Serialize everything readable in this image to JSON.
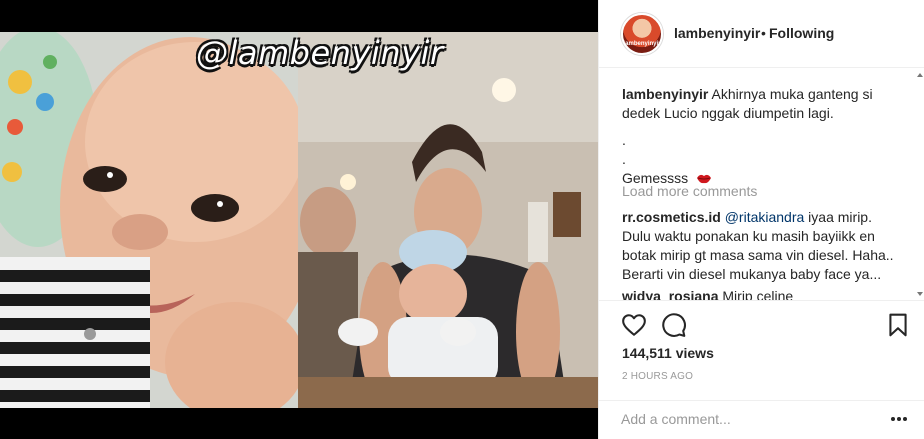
{
  "media": {
    "watermark": "@lambenyinyir"
  },
  "header": {
    "username": "lambenyinyir",
    "separator": "•",
    "follow_status": "Following",
    "avatar_text": "lambenyinyir"
  },
  "caption": {
    "username": "lambenyinyir",
    "text_line1": "Akhirnya muka ganteng si",
    "text_line2": "dedek Lucio nggak diumpetin lagi.",
    "dot1": ".",
    "dot2": ".",
    "text_last": "Gemessss",
    "emoji_icon": "lips-icon"
  },
  "load_more": "Load more comments",
  "comments": [
    {
      "username": "rr.cosmetics.id",
      "mention": "@ritakiandra",
      "text": " iyaa mirip. Dulu waktu ponakan ku masih bayiikk en botak mirip gt masa sama vin diesel. Haha.. Berarti vin diesel mukanya baby face ya..."
    },
    {
      "username": "widya_rosiana",
      "text": " Mirip celine"
    }
  ],
  "actions": {
    "like_icon": "heart-icon",
    "comment_icon": "speech-bubble-icon",
    "save_icon": "bookmark-icon",
    "views": "144,511 views",
    "time": "2 HOURS AGO"
  },
  "add_comment": {
    "placeholder": "Add a comment...",
    "more_icon": "ellipsis-icon"
  },
  "colors": {
    "text": "#262626",
    "muted": "#999999",
    "mention": "#003569",
    "border": "#efefef"
  }
}
